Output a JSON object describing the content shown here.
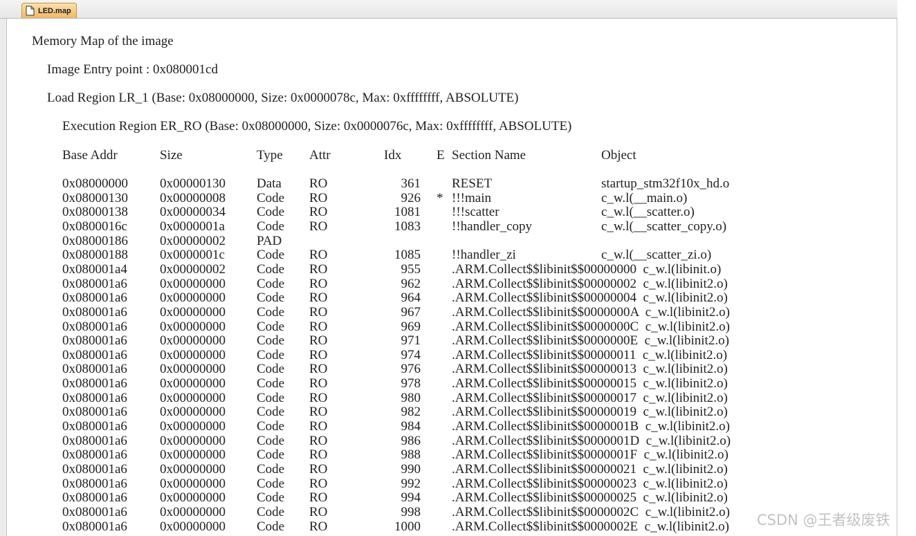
{
  "tab": {
    "label": "LED.map"
  },
  "map": {
    "title": "Memory Map of the image",
    "entry_point": "Image Entry point : 0x080001cd",
    "load_region": "Load Region LR_1 (Base: 0x08000000, Size: 0x0000078c, Max: 0xffffffff, ABSOLUTE)",
    "exec_region": "Execution Region ER_RO (Base: 0x08000000, Size: 0x0000076c, Max: 0xffffffff, ABSOLUTE)",
    "headers": {
      "base": "Base Addr",
      "size": "Size",
      "type": "Type",
      "attr": "Attr",
      "idx": "Idx",
      "e": "E",
      "section": "Section Name",
      "object": "Object"
    },
    "rows": [
      {
        "base": "0x08000000",
        "size": "0x00000130",
        "type": "Data",
        "attr": "RO",
        "idx": "361",
        "e": "",
        "section": "RESET",
        "object": "startup_stm32f10x_hd.o"
      },
      {
        "base": "0x08000130",
        "size": "0x00000008",
        "type": "Code",
        "attr": "RO",
        "idx": "926",
        "e": "*",
        "section": "!!!main",
        "object": "c_w.l(__main.o)"
      },
      {
        "base": "0x08000138",
        "size": "0x00000034",
        "type": "Code",
        "attr": "RO",
        "idx": "1081",
        "e": "",
        "section": "!!!scatter",
        "object": "c_w.l(__scatter.o)"
      },
      {
        "base": "0x0800016c",
        "size": "0x0000001a",
        "type": "Code",
        "attr": "RO",
        "idx": "1083",
        "e": "",
        "section": "!!handler_copy",
        "object": "c_w.l(__scatter_copy.o)"
      },
      {
        "base": "0x08000186",
        "size": "0x00000002",
        "type": "PAD",
        "attr": "",
        "idx": "",
        "e": "",
        "section": "",
        "object": ""
      },
      {
        "base": "0x08000188",
        "size": "0x0000001c",
        "type": "Code",
        "attr": "RO",
        "idx": "1085",
        "e": "",
        "section": "!!handler_zi",
        "object": "c_w.l(__scatter_zi.o)"
      },
      {
        "base": "0x080001a4",
        "size": "0x00000002",
        "type": "Code",
        "attr": "RO",
        "idx": "955",
        "e": "",
        "section": ".ARM.Collect$$libinit$$00000000  c_w.l(libinit.o)",
        "object": ""
      },
      {
        "base": "0x080001a6",
        "size": "0x00000000",
        "type": "Code",
        "attr": "RO",
        "idx": "962",
        "e": "",
        "section": ".ARM.Collect$$libinit$$00000002  c_w.l(libinit2.o)",
        "object": ""
      },
      {
        "base": "0x080001a6",
        "size": "0x00000000",
        "type": "Code",
        "attr": "RO",
        "idx": "964",
        "e": "",
        "section": ".ARM.Collect$$libinit$$00000004  c_w.l(libinit2.o)",
        "object": ""
      },
      {
        "base": "0x080001a6",
        "size": "0x00000000",
        "type": "Code",
        "attr": "RO",
        "idx": "967",
        "e": "",
        "section": ".ARM.Collect$$libinit$$0000000A  c_w.l(libinit2.o)",
        "object": ""
      },
      {
        "base": "0x080001a6",
        "size": "0x00000000",
        "type": "Code",
        "attr": "RO",
        "idx": "969",
        "e": "",
        "section": ".ARM.Collect$$libinit$$0000000C  c_w.l(libinit2.o)",
        "object": ""
      },
      {
        "base": "0x080001a6",
        "size": "0x00000000",
        "type": "Code",
        "attr": "RO",
        "idx": "971",
        "e": "",
        "section": ".ARM.Collect$$libinit$$0000000E  c_w.l(libinit2.o)",
        "object": ""
      },
      {
        "base": "0x080001a6",
        "size": "0x00000000",
        "type": "Code",
        "attr": "RO",
        "idx": "974",
        "e": "",
        "section": ".ARM.Collect$$libinit$$00000011  c_w.l(libinit2.o)",
        "object": ""
      },
      {
        "base": "0x080001a6",
        "size": "0x00000000",
        "type": "Code",
        "attr": "RO",
        "idx": "976",
        "e": "",
        "section": ".ARM.Collect$$libinit$$00000013  c_w.l(libinit2.o)",
        "object": ""
      },
      {
        "base": "0x080001a6",
        "size": "0x00000000",
        "type": "Code",
        "attr": "RO",
        "idx": "978",
        "e": "",
        "section": ".ARM.Collect$$libinit$$00000015  c_w.l(libinit2.o)",
        "object": ""
      },
      {
        "base": "0x080001a6",
        "size": "0x00000000",
        "type": "Code",
        "attr": "RO",
        "idx": "980",
        "e": "",
        "section": ".ARM.Collect$$libinit$$00000017  c_w.l(libinit2.o)",
        "object": ""
      },
      {
        "base": "0x080001a6",
        "size": "0x00000000",
        "type": "Code",
        "attr": "RO",
        "idx": "982",
        "e": "",
        "section": ".ARM.Collect$$libinit$$00000019  c_w.l(libinit2.o)",
        "object": ""
      },
      {
        "base": "0x080001a6",
        "size": "0x00000000",
        "type": "Code",
        "attr": "RO",
        "idx": "984",
        "e": "",
        "section": ".ARM.Collect$$libinit$$0000001B  c_w.l(libinit2.o)",
        "object": ""
      },
      {
        "base": "0x080001a6",
        "size": "0x00000000",
        "type": "Code",
        "attr": "RO",
        "idx": "986",
        "e": "",
        "section": ".ARM.Collect$$libinit$$0000001D  c_w.l(libinit2.o)",
        "object": ""
      },
      {
        "base": "0x080001a6",
        "size": "0x00000000",
        "type": "Code",
        "attr": "RO",
        "idx": "988",
        "e": "",
        "section": ".ARM.Collect$$libinit$$0000001F  c_w.l(libinit2.o)",
        "object": ""
      },
      {
        "base": "0x080001a6",
        "size": "0x00000000",
        "type": "Code",
        "attr": "RO",
        "idx": "990",
        "e": "",
        "section": ".ARM.Collect$$libinit$$00000021  c_w.l(libinit2.o)",
        "object": ""
      },
      {
        "base": "0x080001a6",
        "size": "0x00000000",
        "type": "Code",
        "attr": "RO",
        "idx": "992",
        "e": "",
        "section": ".ARM.Collect$$libinit$$00000023  c_w.l(libinit2.o)",
        "object": ""
      },
      {
        "base": "0x080001a6",
        "size": "0x00000000",
        "type": "Code",
        "attr": "RO",
        "idx": "994",
        "e": "",
        "section": ".ARM.Collect$$libinit$$00000025  c_w.l(libinit2.o)",
        "object": ""
      },
      {
        "base": "0x080001a6",
        "size": "0x00000000",
        "type": "Code",
        "attr": "RO",
        "idx": "998",
        "e": "",
        "section": ".ARM.Collect$$libinit$$0000002C  c_w.l(libinit2.o)",
        "object": ""
      },
      {
        "base": "0x080001a6",
        "size": "0x00000000",
        "type": "Code",
        "attr": "RO",
        "idx": "1000",
        "e": "",
        "section": ".ARM.Collect$$libinit$$0000002E  c_w.l(libinit2.o)",
        "object": ""
      }
    ]
  },
  "watermark": "CSDN @王者级废铁"
}
